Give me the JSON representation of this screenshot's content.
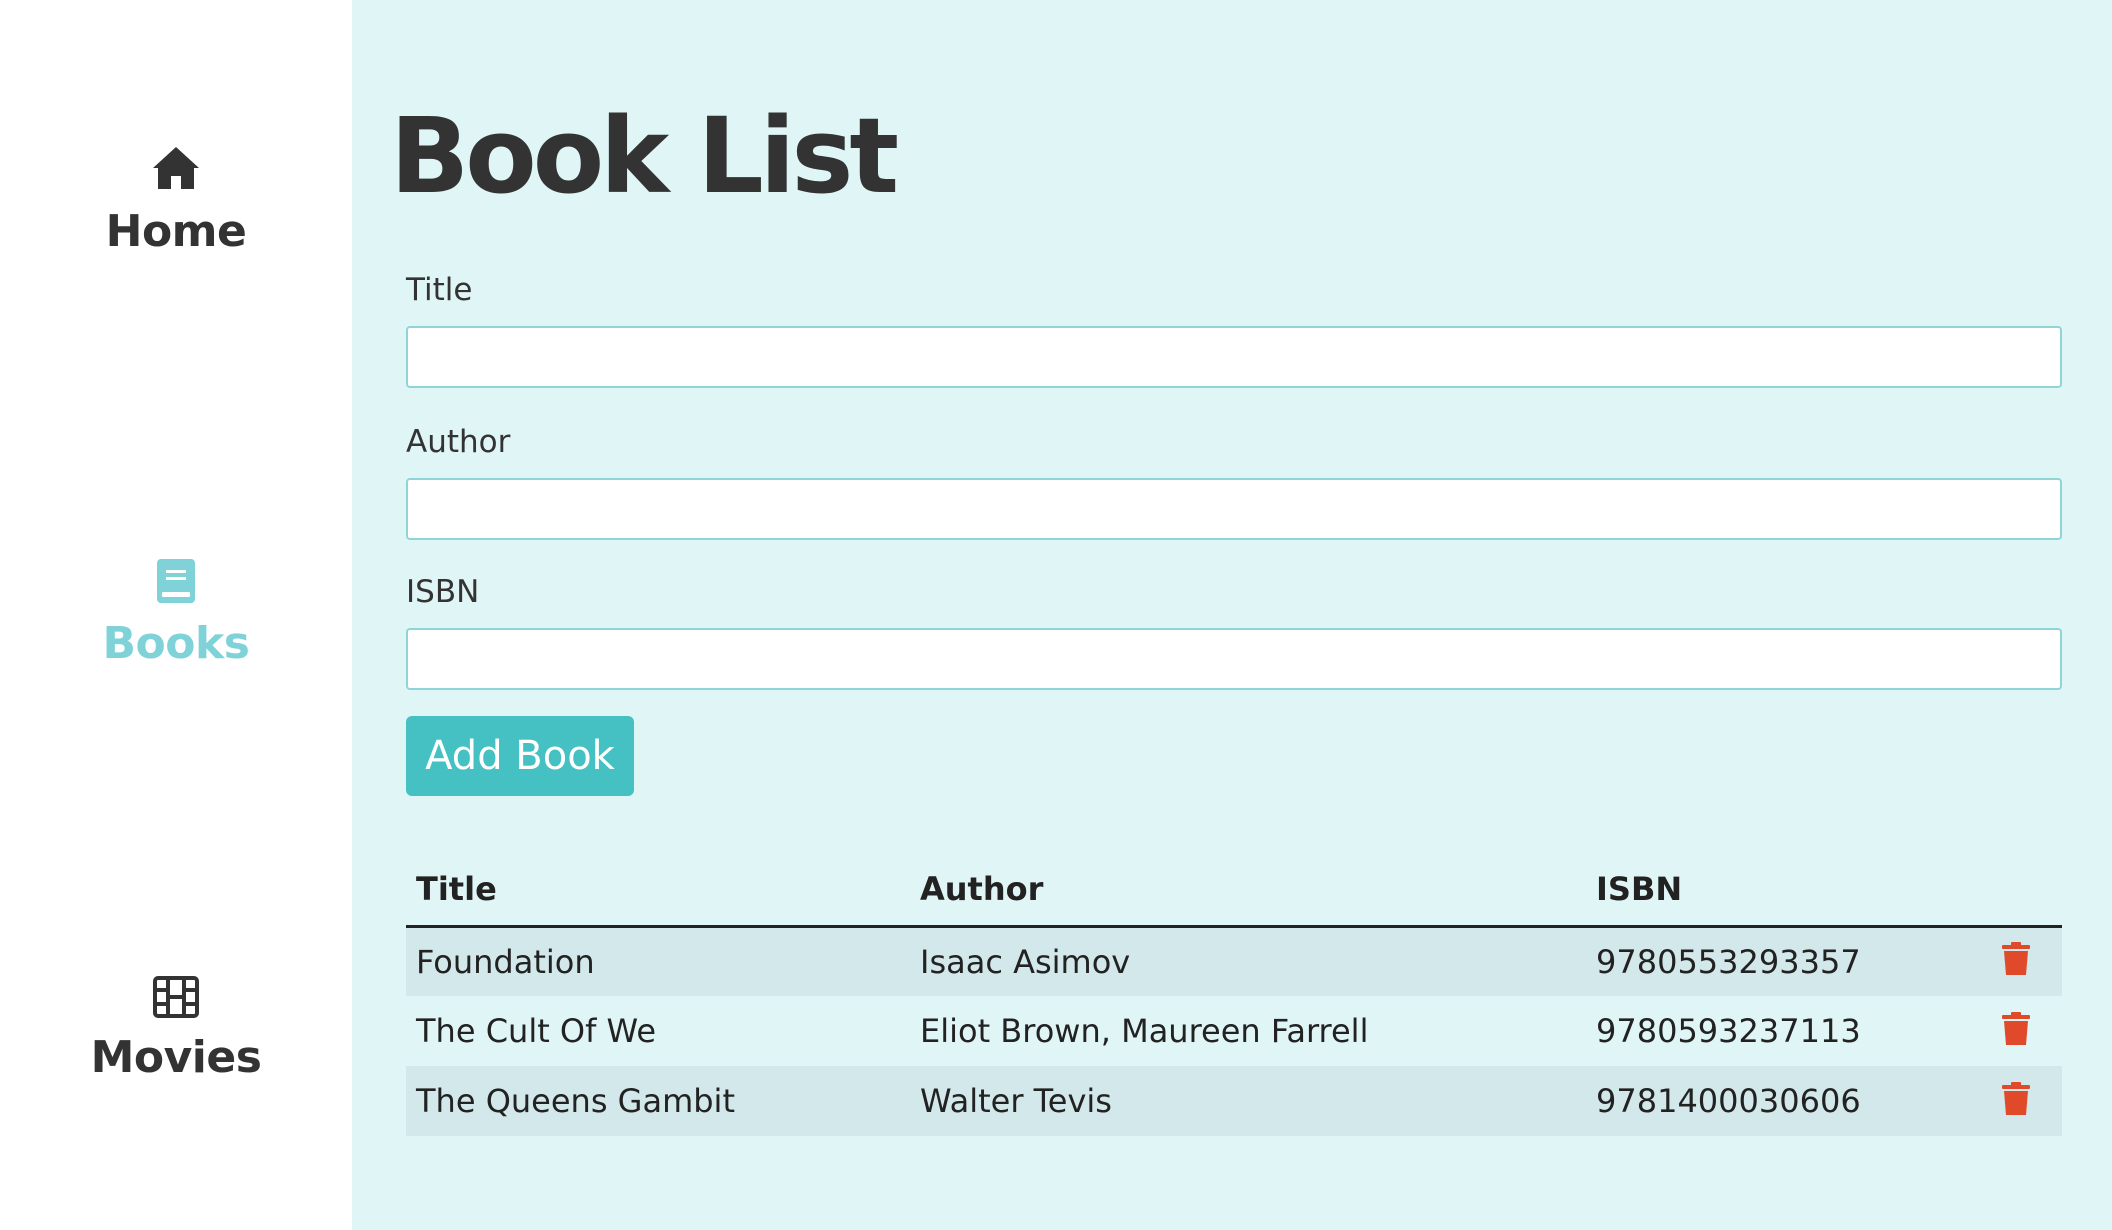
{
  "sidebar": {
    "items": [
      {
        "label": "Home",
        "icon": "home-icon",
        "active": false
      },
      {
        "label": "Books",
        "icon": "book-icon",
        "active": true
      },
      {
        "label": "Movies",
        "icon": "film-icon",
        "active": false
      }
    ]
  },
  "main": {
    "title": "Book List",
    "form": {
      "title_label": "Title",
      "title_value": "",
      "author_label": "Author",
      "author_value": "",
      "isbn_label": "ISBN",
      "isbn_value": ""
    },
    "add_button_label": "Add Book"
  },
  "table": {
    "headers": [
      "Title",
      "Author",
      "ISBN",
      ""
    ],
    "rows": [
      {
        "title": "Foundation",
        "author": "Isaac Asimov",
        "isbn": "9780553293357"
      },
      {
        "title": "The Cult Of We",
        "author": "Eliot Brown, Maureen Farrell",
        "isbn": "9780593237113"
      },
      {
        "title": "The Queens Gambit",
        "author": "Walter Tevis",
        "isbn": "9781400030606"
      }
    ]
  },
  "colors": {
    "accent": "#45c1c3",
    "active_nav": "#7fd3d8",
    "background": "#e0f5f6",
    "delete": "#e04a2a"
  }
}
